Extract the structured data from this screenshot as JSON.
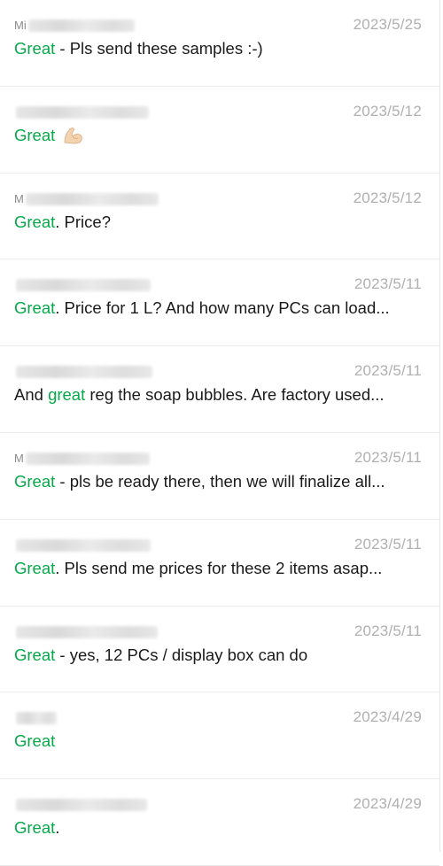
{
  "results": [
    {
      "sender_initial": "Mi",
      "date": "2023/5/25",
      "highlight": "Great",
      "highlight_case": "cap",
      "prefix": "",
      "rest": " - Pls send these samples :-)",
      "emoji": ""
    },
    {
      "sender_initial": "",
      "date": "2023/5/12",
      "highlight": "Great",
      "prefix": "",
      "rest": "",
      "emoji": "flexed-biceps"
    },
    {
      "sender_initial": "M",
      "date": "2023/5/12",
      "highlight": "Great",
      "prefix": "",
      "rest": ". Price?",
      "emoji": ""
    },
    {
      "sender_initial": "",
      "date": "2023/5/11",
      "highlight": "Great",
      "prefix": "",
      "rest": ". Price for 1 L? And how many PCs  can load...",
      "emoji": ""
    },
    {
      "sender_initial": "",
      "date": "2023/5/11",
      "highlight": "great",
      "prefix": "And ",
      "rest": " reg the soap bubbles. Are factory used...",
      "emoji": ""
    },
    {
      "sender_initial": "M",
      "date": "2023/5/11",
      "highlight": "Great",
      "prefix": "",
      "rest": " - pls be ready there, then we will finalize all...",
      "emoji": ""
    },
    {
      "sender_initial": "",
      "date": "2023/5/11",
      "highlight": "Great",
      "prefix": "",
      "rest": ". Pls send me prices for these 2 items asap...",
      "emoji": ""
    },
    {
      "sender_initial": "",
      "date": "2023/5/11",
      "highlight": "Great",
      "prefix": "",
      "rest": " - yes, 12 PCs / display box can do",
      "emoji": ""
    },
    {
      "sender_initial": "",
      "date": "2023/4/29",
      "highlight": "Great",
      "prefix": "",
      "rest": "",
      "emoji": ""
    },
    {
      "sender_initial": "",
      "date": "2023/4/29",
      "highlight": "Great",
      "prefix": "",
      "rest": ".",
      "emoji": ""
    }
  ],
  "colors": {
    "highlight": "#07a84a",
    "date": "#b0b0b0",
    "text": "#1a1a1a",
    "divider": "#ececec"
  }
}
